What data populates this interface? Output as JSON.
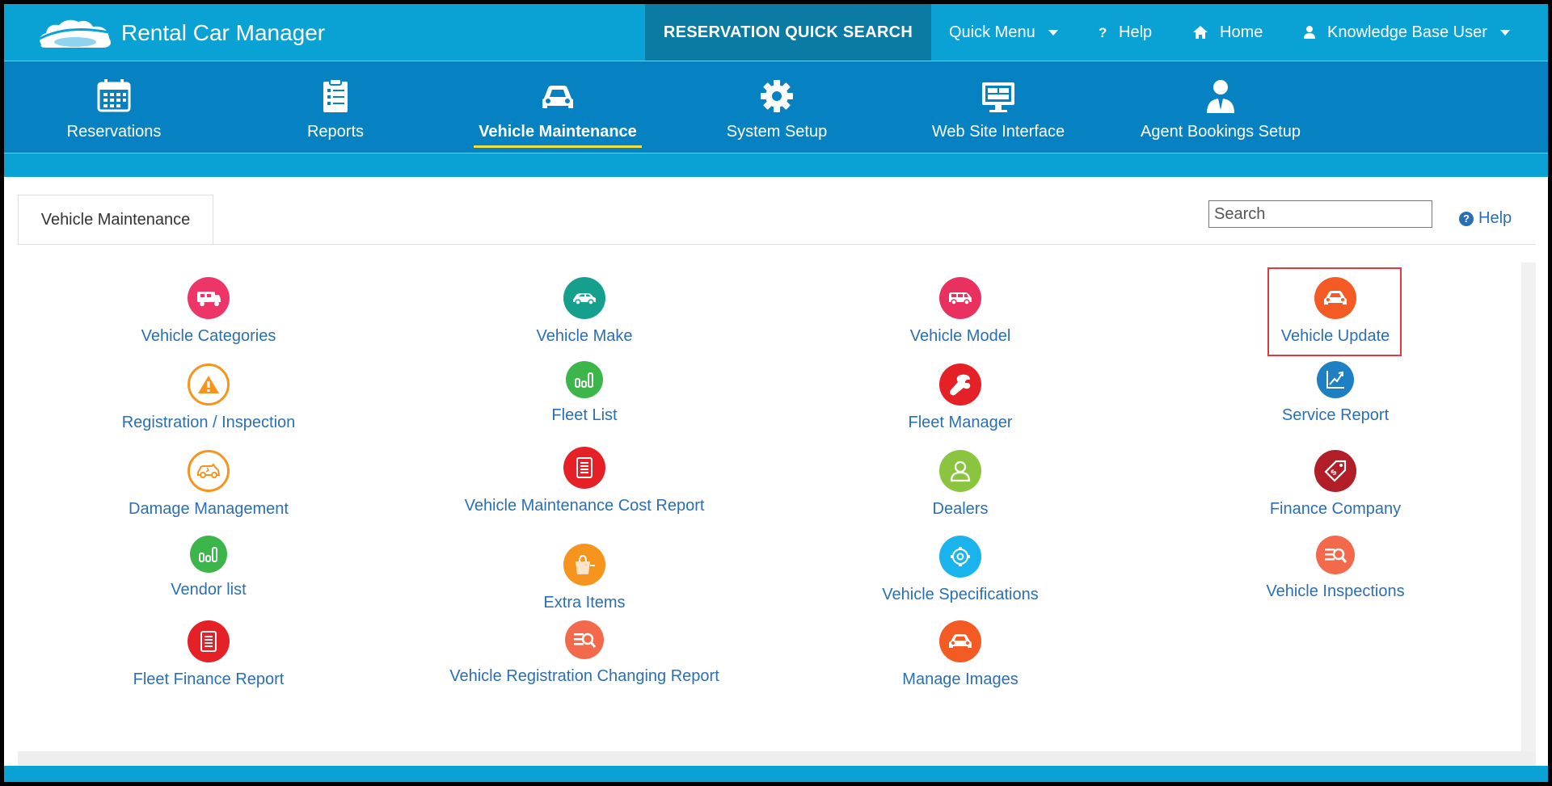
{
  "app": {
    "title": "Rental Car Manager"
  },
  "topbar": {
    "quick_search": "RESERVATION QUICK SEARCH",
    "quick_menu": "Quick Menu",
    "help": "Help",
    "home": "Home",
    "user": "Knowledge Base User"
  },
  "mainnav": {
    "items": [
      {
        "label": "Reservations",
        "icon": "calendar-icon"
      },
      {
        "label": "Reports",
        "icon": "clipboard-icon"
      },
      {
        "label": "Vehicle Maintenance",
        "icon": "car-icon",
        "active": true
      },
      {
        "label": "System Setup",
        "icon": "gear-icon"
      },
      {
        "label": "Web Site Interface",
        "icon": "monitor-icon"
      },
      {
        "label": "Agent Bookings Setup",
        "icon": "agent-icon"
      }
    ]
  },
  "content": {
    "tab_label": "Vehicle Maintenance",
    "search_placeholder": "Search",
    "help_label": "Help"
  },
  "tiles": [
    {
      "label": "Vehicle Categories",
      "color": "#ee3567",
      "icon": "camper-icon"
    },
    {
      "label": "Vehicle Make",
      "color": "#15a08d",
      "icon": "car-side-icon"
    },
    {
      "label": "Vehicle Model",
      "color": "#e8315f",
      "icon": "van-icon"
    },
    {
      "label": "Vehicle Update",
      "color": "#f45a24",
      "icon": "car-front-icon"
    },
    {
      "label": "Registration / Inspection",
      "color": "#f7941d",
      "icon": "warning-icon"
    },
    {
      "label": "Fleet List",
      "color": "#3cb54a",
      "icon": "bar-chart-icon"
    },
    {
      "label": "Fleet Manager",
      "color": "#e62027",
      "icon": "wrench-icon"
    },
    {
      "label": "Service Report",
      "color": "#1e7fc2",
      "icon": "trend-chart-icon"
    },
    {
      "label": "Damage Management",
      "color": "#f7941d",
      "icon": "damaged-car-icon"
    },
    {
      "label": "Vehicle Maintenance Cost Report",
      "color": "#e62027",
      "icon": "report-icon"
    },
    {
      "label": "Dealers",
      "color": "#8bc53f",
      "icon": "person-icon"
    },
    {
      "label": "Finance Company",
      "color": "#b21e28",
      "icon": "price-tag-icon"
    },
    {
      "label": "Vendor list",
      "color": "#3cb54a",
      "icon": "bar-chart-icon"
    },
    {
      "label": "Extra Items",
      "color": "#f7941d",
      "icon": "bag-icon"
    },
    {
      "label": "Vehicle Specifications",
      "color": "#1ab3ec",
      "icon": "gear-icon"
    },
    {
      "label": "Vehicle Inspections",
      "color": "#f26a4b",
      "icon": "search-list-icon"
    },
    {
      "label": "Fleet Finance Report",
      "color": "#e62027",
      "icon": "report-icon"
    },
    {
      "label": "Vehicle Registration Changing Report",
      "color": "#f26a4b",
      "icon": "search-list-icon"
    },
    {
      "label": "Manage Images",
      "color": "#f45a24",
      "icon": "car-front-icon"
    }
  ]
}
